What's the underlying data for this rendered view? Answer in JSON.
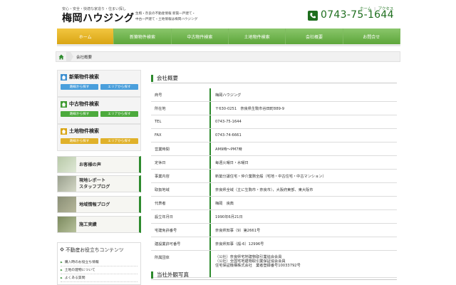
{
  "header": {
    "tagline": "安心・安全・快適な家造り・住まい探し",
    "logo": "梅岡ハウジング",
    "desc_line1": "生駒・奈良の不動産情報 新築一戸建て・",
    "desc_line2": "中古一戸建て・土地情報は梅岡ハウジング",
    "link_home": "ホーム",
    "link_sep": "|",
    "link_access": "アクセス",
    "phone": "0743-75-1644"
  },
  "nav": [
    {
      "label": "ホーム",
      "active": true
    },
    {
      "label": "新築物件検索",
      "active": false
    },
    {
      "label": "中古物件検索",
      "active": false
    },
    {
      "label": "土地物件検索",
      "active": false
    },
    {
      "label": "会社概要",
      "active": false
    },
    {
      "label": "お問合せ",
      "active": false
    }
  ],
  "breadcrumb": {
    "current": "会社概要"
  },
  "sidebar": {
    "search_boxes": [
      {
        "title": "新築物件検索",
        "btn1": "路線から探す",
        "btn2": "エリアから探す",
        "color": "#4a9fdc",
        "icon_color": "#3d8fd0"
      },
      {
        "title": "中古物件検索",
        "btn1": "路線から探す",
        "btn2": "エリアから探す",
        "color": "#4caa3c",
        "icon_color": "#3f9a32"
      },
      {
        "title": "土地物件検索",
        "btn1": "路線から探す",
        "btn2": "エリアから探す",
        "color": "#e0b12a",
        "icon_color": "#d9a514"
      }
    ],
    "banners": [
      {
        "label1": "お客様の声",
        "label2": ""
      },
      {
        "label1": "現地レポート",
        "label2": "スタッフブログ"
      },
      {
        "label1": "地域情報ブログ",
        "label2": ""
      },
      {
        "label1": "施工実績",
        "label2": ""
      }
    ],
    "useful": {
      "title": "不動産お役立ちコンテンツ",
      "items": [
        "購入時のお役立ち情報",
        "土地の建物について",
        "よくある質問"
      ]
    }
  },
  "main": {
    "section_title": "会社概要",
    "rows": [
      {
        "label": "商号",
        "value": "梅岡ハウジング"
      },
      {
        "label": "所在地",
        "value": "〒630-0251　奈良県生駒市谷田町889-9"
      },
      {
        "label": "TEL",
        "value": "0743-75-1644"
      },
      {
        "label": "FAX",
        "value": "0743-74-6661"
      },
      {
        "label": "営業時間",
        "value": "AM9時～PM7時"
      },
      {
        "label": "定休日",
        "value": "毎週火曜日・水曜日"
      },
      {
        "label": "事業内容",
        "value": "新築分譲住宅・仲介業務全般（宅地・中古住宅・中古マンション）"
      },
      {
        "label": "取扱地域",
        "value": "奈良県全域（主に生駒市・奈良市），大阪府東部、東大阪市"
      },
      {
        "label": "代表者",
        "value": "梅岡　良典"
      },
      {
        "label": "設立年月日",
        "value": "1990年6月21日"
      },
      {
        "label": "宅建免許番号",
        "value": "奈良県知事（9）第2661号"
      },
      {
        "label": "建設業許可番号",
        "value": "奈良県知事（般-6）12996号"
      }
    ],
    "org_row": {
      "label": "所属団体",
      "lines": [
        "（公社）奈良県宅地建物取引業協会会員",
        "（公社）全国宅地建物取引業保証協会会員",
        "住宅保証機構株式会社　業者登録番号10033792号"
      ]
    },
    "section2_title": "当社外観写真"
  },
  "colors": {
    "green": "#2d8a2d",
    "nav_green": "#5da63a",
    "nav_active": "#d9a514"
  }
}
